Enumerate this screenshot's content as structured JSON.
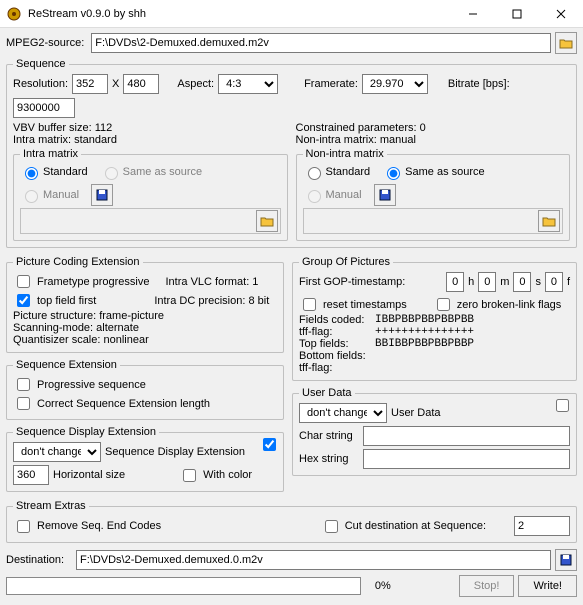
{
  "window": {
    "title": "ReStream v0.9.0 by shh"
  },
  "source": {
    "label": "MPEG2-source:",
    "value": "F:\\DVDs\\2-Demuxed.demuxed.m2v"
  },
  "sequence": {
    "legend": "Sequence",
    "res_label": "Resolution:",
    "w": "352",
    "x": "X",
    "h": "480",
    "aspect_label": "Aspect:",
    "aspect": "4:3",
    "framerate_label": "Framerate:",
    "framerate": "29.970",
    "bitrate_label": "Bitrate [bps]:",
    "bitrate": "9300000",
    "vbv": "VBV buffer size: 112",
    "constrained": "Constrained parameters: 0",
    "intra_matrix_s": "Intra matrix: standard",
    "nonintra_matrix_s": "Non-intra matrix: manual",
    "im": {
      "legend": "Intra matrix",
      "r1": "Standard",
      "r2": "Same as source",
      "r3": "Manual"
    },
    "nim": {
      "legend": "Non-intra matrix",
      "r1": "Standard",
      "r2": "Same as source",
      "r3": "Manual"
    }
  },
  "pce": {
    "legend": "Picture Coding Extension",
    "c1": "Frametype progressive",
    "ivlc": "Intra VLC format: 1",
    "c2": "top field first",
    "idc": "Intra DC precision: 8 bit",
    "ps": "Picture structure: frame-picture",
    "sm": "Scanning-mode: alternate",
    "qs": "Quantisizer scale: nonlinear"
  },
  "gop": {
    "legend": "Group Of Pictures",
    "first": "First GOP-timestamp:",
    "h": "h",
    "m": "m",
    "s": "s",
    "f": "f",
    "hv": "0",
    "mv": "0",
    "sv": "0",
    "fv": "0",
    "reset": "reset timestamps",
    "zero": "zero broken-link flags",
    "fields_coded_l": "Fields coded:",
    "fields_coded": "IBBPBBPBBPBBPBB",
    "tff_l": "tff-flag:",
    "tff": "+++++++++++++++",
    "top_l": "Top fields:",
    "top": "BBIBBPBBPBBPBBP",
    "bottom_l": "Bottom fields:",
    "tff2_l": "tff-flag:"
  },
  "se": {
    "legend": "Sequence Extension",
    "c1": "Progressive sequence",
    "c2": "Correct Sequence Extension length"
  },
  "ud": {
    "legend": "User Data",
    "sel": "don't change",
    "lbl": "User Data",
    "char": "Char string",
    "hex": "Hex string"
  },
  "sde": {
    "legend": "Sequence Display Extension",
    "sel": "don't change",
    "lbl": "Sequence Display Extension",
    "hs": "360",
    "hslbl": "Horizontal size",
    "wc": "With color"
  },
  "extras": {
    "legend": "Stream Extras",
    "rem": "Remove Seq. End Codes",
    "cut": "Cut destination at Sequence:",
    "cutv": "2"
  },
  "dest": {
    "label": "Destination:",
    "value": "F:\\DVDs\\2-Demuxed.demuxed.0.m2v"
  },
  "footer": {
    "pct": "0%",
    "status": "",
    "stop": "Stop!",
    "write": "Write!"
  }
}
